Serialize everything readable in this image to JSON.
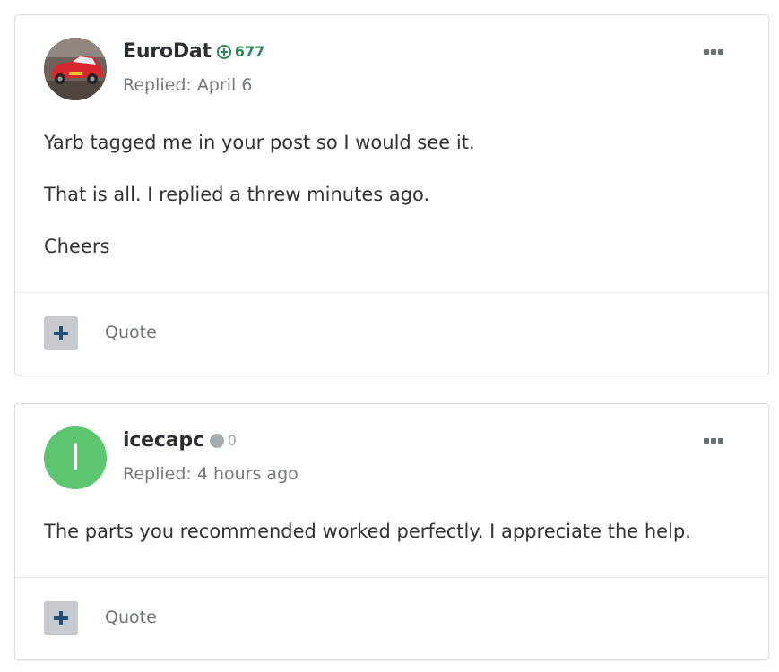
{
  "posts": [
    {
      "author": "EuroDat",
      "reputation": "677",
      "reputation_type": "positive",
      "replied": "Replied: April 6",
      "avatar_type": "photo",
      "paragraphs": [
        "Yarb tagged me in your post so I would see it.",
        "That is all. I replied a threw minutes ago.",
        "Cheers"
      ],
      "quote_label": "Quote"
    },
    {
      "author": "icecapc",
      "reputation": "0",
      "reputation_type": "neutral",
      "replied": "Replied: 4 hours ago",
      "avatar_type": "letter",
      "avatar_letter": "I",
      "avatar_color": "#5cc671",
      "paragraphs": [
        "The parts you recommended worked perfectly. I appreciate the help."
      ],
      "quote_label": "Quote"
    }
  ],
  "colors": {
    "positive_rep": "#2c8a57",
    "neutral_rep": "#a7acb0",
    "plus_button_bg": "#c7cbcf",
    "plus_icon": "#1f4f77"
  },
  "icons": {
    "menu": "ellipsis-icon",
    "reputation_positive": "plus-circle-icon",
    "reputation_neutral": "dot-icon",
    "multiquote": "plus-icon"
  }
}
